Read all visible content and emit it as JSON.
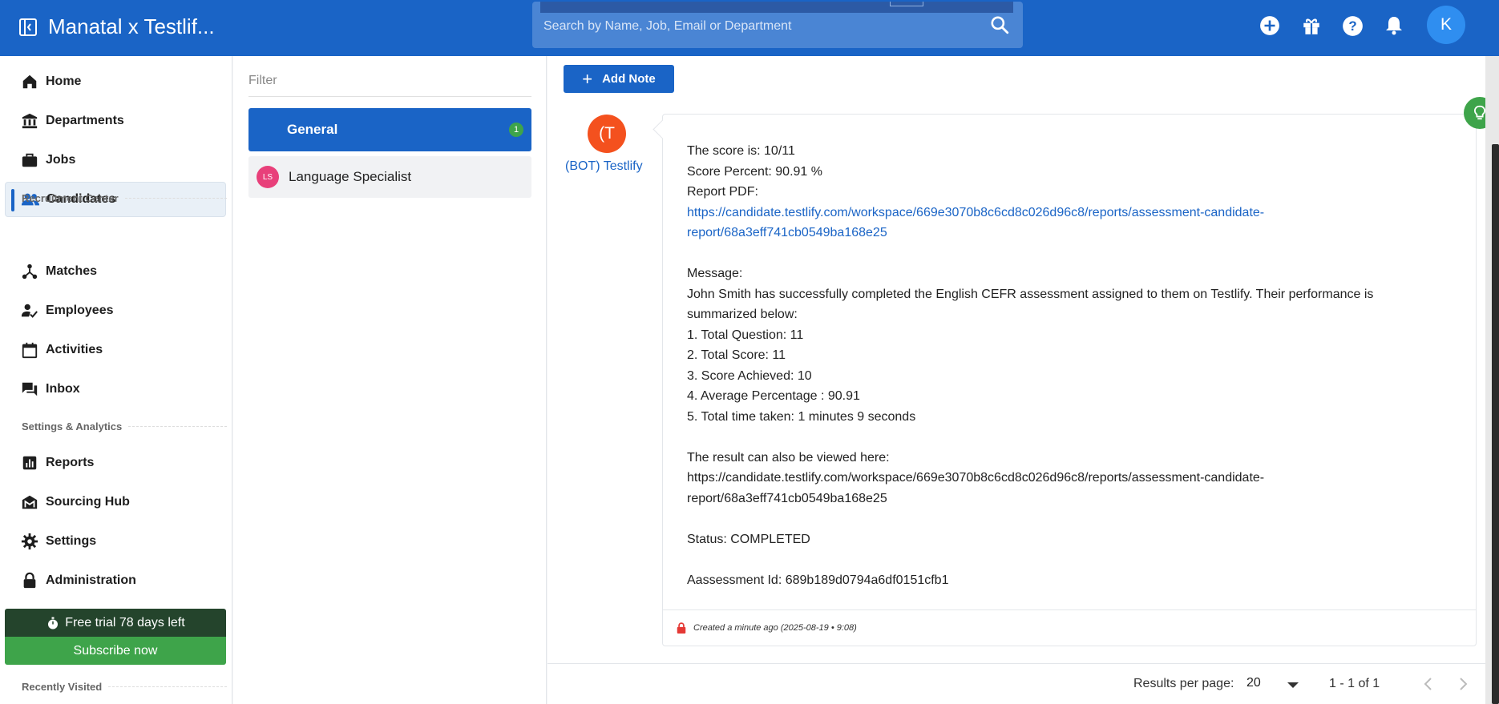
{
  "header": {
    "app_title": "Manatal x Testlif...",
    "search_placeholder": "Search by Name, Job, Email or Department",
    "avatar_initial": "K"
  },
  "sidebar": {
    "items_top": [
      {
        "label": "Home",
        "icon": "home-icon"
      },
      {
        "label": "Departments",
        "icon": "bank-icon"
      },
      {
        "label": "Jobs",
        "icon": "briefcase-icon"
      },
      {
        "label": "Candidates",
        "icon": "people-icon",
        "active": true
      }
    ],
    "section_recruitment": "Recruitment Center",
    "items_recruitment": [
      {
        "label": "Matches",
        "icon": "hub-icon"
      },
      {
        "label": "Employees",
        "icon": "person-check-icon"
      },
      {
        "label": "Activities",
        "icon": "calendar-icon"
      },
      {
        "label": "Inbox",
        "icon": "forum-icon"
      }
    ],
    "section_settings": "Settings & Analytics",
    "items_settings": [
      {
        "label": "Reports",
        "icon": "bar-chart-icon"
      },
      {
        "label": "Sourcing Hub",
        "icon": "sourcing-icon"
      },
      {
        "label": "Settings",
        "icon": "gear-icon"
      },
      {
        "label": "Administration",
        "icon": "lock-icon"
      }
    ],
    "trial_text": "Free trial 78 days left",
    "subscribe_label": "Subscribe now",
    "recently_visited": "Recently Visited"
  },
  "filter": {
    "label": "Filter",
    "general_label": "General",
    "general_count": "1",
    "lang_initials": "LS",
    "lang_label": "Language Specialist"
  },
  "notes": {
    "add_note_label": "Add Note",
    "bot_initial": "(T",
    "bot_name": "(BOT) Testlify",
    "lines": {
      "score": "The score is: 10/11",
      "percent": "Score Percent: 90.91 %",
      "report_pdf": "Report PDF:",
      "report_link_1": "https://candidate.testlify.com/workspace/669e3070b8c6cd8c026d96c8/reports/assessment-candidate-",
      "report_link_2": "report/68a3eff741cb0549ba168e25",
      "message_label": "Message:",
      "message_1": "John Smith has successfully completed the English CEFR assessment assigned to them on Testlify. Their performance is",
      "message_2": "summarized below:",
      "item_1": "1. Total Question: 11",
      "item_2": "2. Total Score: 11",
      "item_3": "3. Score Achieved: 10",
      "item_4": "4. Average Percentage : 90.91",
      "item_5": "5. Total time taken: 1 minutes 9 seconds",
      "result_label": "The result can also be viewed here:",
      "result_link_1": "https://candidate.testlify.com/workspace/669e3070b8c6cd8c026d96c8/reports/assessment-candidate-",
      "result_link_2": "report/68a3eff741cb0549ba168e25",
      "status": "Status: COMPLETED",
      "assessment_id": "Aassessment Id: 689b189d0794a6df0151cfb1"
    },
    "created": "Created a minute ago (2025-08-19 • 9:08)"
  },
  "pager": {
    "results_label": "Results per page:",
    "per_page": "20",
    "range": "1 - 1 of 1"
  },
  "colors": {
    "brand": "#1a64c6",
    "green": "#3ea44a",
    "bot_avatar": "#f4511e"
  }
}
